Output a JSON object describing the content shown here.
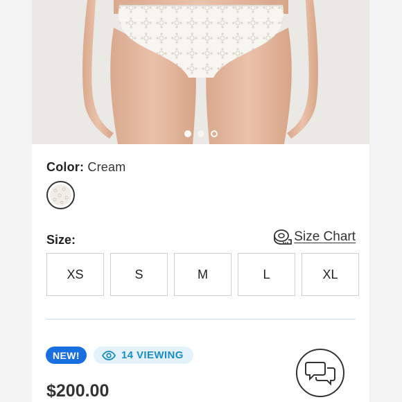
{
  "product": {
    "color_label": "Color:",
    "color_value": "Cream",
    "swatch_color": "#f0eee6",
    "size_label": "Size:",
    "size_chart_label": "Size Chart",
    "sizes": [
      "XS",
      "S",
      "M",
      "L",
      "XL"
    ],
    "price": "$200.00"
  },
  "gallery": {
    "image_count": 3,
    "active_index": 0
  },
  "badges": {
    "new_label": "NEW!",
    "viewing_label": "14 VIEWING"
  },
  "colors": {
    "accent_blue": "#1a6fe0",
    "viewing_text": "#1a8cc8",
    "viewing_bg": "#e3f2fb",
    "divider": "#c6d9ee"
  },
  "icons": {
    "size_chart": "measuring-tape-icon",
    "viewing": "eye-icon",
    "chat": "chat-bubbles-icon"
  }
}
